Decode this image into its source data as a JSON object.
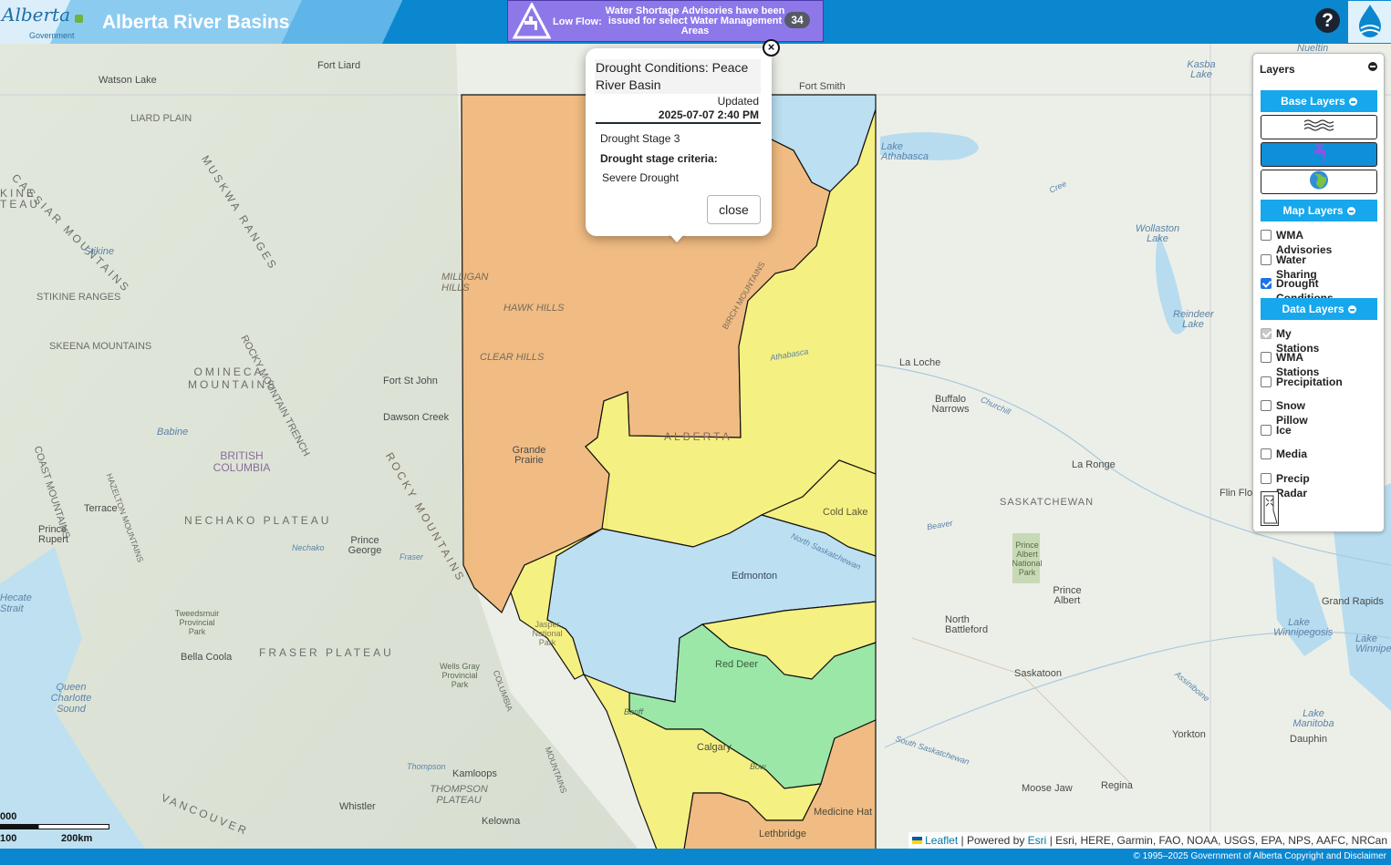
{
  "header": {
    "logo_text": "Alberta",
    "logo_sub": "Government",
    "title": "Alberta River Basins",
    "alert_label": "Low Flow:",
    "alert_message": "Water Shortage Advisories have been issued for select Water Management Areas",
    "alert_count": "34",
    "help_icon": "?"
  },
  "popup": {
    "title": "Drought Conditions: Peace River Basin",
    "updated_label": "Updated",
    "updated_date": "2025-07-07 2:40 PM",
    "stage": "Drought Stage 3",
    "criteria_label": "Drought stage criteria:",
    "criteria_value": "Severe Drought",
    "close_label": "close",
    "close_icon": "×"
  },
  "layers": {
    "title": "Layers",
    "base_layers_label": "Base Layers",
    "base_icons": [
      "waves-icon",
      "tap-icon",
      "globe-icon"
    ],
    "base_active_index": 1,
    "map_layers_label": "Map Layers",
    "map_layers": [
      {
        "label": "WMA Advisories",
        "checked": false,
        "disabled": false
      },
      {
        "label": "Water Sharing",
        "checked": false,
        "disabled": false
      },
      {
        "label": "Drought Conditions",
        "checked": true,
        "disabled": false
      }
    ],
    "data_layers_label": "Data Layers",
    "data_layers": [
      {
        "label": "My Stations",
        "checked": true,
        "disabled": true
      },
      {
        "label": "WMA Stations",
        "checked": false,
        "disabled": false
      },
      {
        "label": "Precipitation",
        "checked": false,
        "disabled": false
      },
      {
        "label": "Snow Pillow",
        "checked": false,
        "disabled": false
      },
      {
        "label": "Ice",
        "checked": false,
        "disabled": false
      },
      {
        "label": "Media",
        "checked": false,
        "disabled": false
      },
      {
        "label": "Precip Radar",
        "checked": false,
        "disabled": false
      }
    ]
  },
  "map": {
    "colors": {
      "severe": "#f0b77a",
      "moderate": "#f6ef7c",
      "normal": "#b9def2",
      "wet": "#97e6a4",
      "header": "#0b87d0",
      "alert": "#8e78e9"
    },
    "labels": {
      "fort_liard": "Fort Liard",
      "watson_lake": "Watson Lake",
      "liard_plain": "LIARD PLAIN",
      "cassiar": "CASSIAR MOUNTAINS",
      "muskwa": "MUSKWA RANGES",
      "kine_teau": "KINE TEAU",
      "stikine": "Stikine",
      "stikine_ranges": "STIKINE RANGES",
      "skeena": "SKEENA MOUNTAINS",
      "omineca": "OMINECA MOUNTAINS",
      "rocky_trench": "ROCKY MOUNTAIN TRENCH",
      "milligan": "MILLIGAN HILLS",
      "hawk": "HAWK HILLS",
      "clear": "CLEAR HILLS",
      "fort_st_john": "Fort St John",
      "dawson": "Dawson Creek",
      "babine": "Babine",
      "bc": "BRITISH COLUMBIA",
      "grande": "Grande Prairie",
      "terrace": "Terrace",
      "prince_rupert": "Prince Rupert",
      "nechako": "NECHAKO PLATEAU",
      "nechako_river": "Nechako",
      "prince_george": "Prince George",
      "fraser_river": "Fraser",
      "tweedsmuir": "Tweedsmuir Provincial Park",
      "bella": "Bella Coola",
      "fraser_plateau": "FRASER PLATEAU",
      "wells": "Wells Gray Provincial Park",
      "jasper": "Jasper National Park",
      "queen": "Queen Charlotte Sound",
      "hecate": "Hecate Strait",
      "thompson": "Thompson",
      "kamloops": "Kamloops",
      "thompson_plateau": "THOMPSON PLATEAU",
      "whistler": "Whistler",
      "kelowna": "Kelowna",
      "vancouver": "VANCOUVER",
      "fort_smith": "Fort Smith",
      "lake_athabasca": "Lake Athabasca",
      "nueltin": "Nueltin",
      "kasba": "Kasba Lake",
      "cree": "Cree",
      "wollaston": "Wollaston Lake",
      "reindeer": "Reindeer Lake",
      "la_loche": "La Loche",
      "buffalo": "Buffalo Narrows",
      "churchill": "Churchill",
      "la_ronge": "La Ronge",
      "saskatchewan": "SASKATCHEWAN",
      "flin": "Flin Flo",
      "beaver": "Beaver",
      "cold_lake": "Cold Lake",
      "edmonton": "Edmonton",
      "n_sask": "North Saskatchewan",
      "athabasca": "Athabasca",
      "prince_albert_park": "Prince Albert National Park",
      "prince_albert": "Prince Albert",
      "north_battleford": "North Battleford",
      "saskatoon": "Saskatoon",
      "grand_rapids": "Grand Rapids",
      "lake_winnipegosis": "Lake Winnipegosis",
      "lake_winnipeg": "Lake Winnipe",
      "assiniboine": "Assiniboine",
      "lake_manitoba": "Lake Manitoba",
      "yorkton": "Yorkton",
      "dauphin": "Dauphin",
      "s_sask": "South Saskatchewan",
      "moose_jaw": "Moose Jaw",
      "regina": "Regina",
      "red_deer": "Red Deer",
      "calgary": "Calgary",
      "medicine_hat": "Medicine Hat",
      "lethbridge": "Lethbridge",
      "columbia": "COLUMBIA",
      "rocky": "ROCKY MOUNTAINS",
      "birch": "BIRCH MOUNTAINS",
      "alberta_w": "ALBERTA",
      "banff": "Banff",
      "coast": "COAST MOUNTAINS",
      "hazelton": "HAZELTON MOUNTAINS",
      "monashee": "MOUNTAINS",
      "bow": "Bow"
    }
  },
  "scale": {
    "top": "000",
    "left": "100",
    "right": "200km"
  },
  "attribution": {
    "leaflet": "Leaflet",
    "powered": "| Powered by",
    "esri": "Esri",
    "sources": "| Esri, HERE, Garmin, FAO, NOAA, USGS, EPA, NPS, AAFC, NRCan"
  },
  "footer": "© 1995–2025 Government of Alberta Copyright and Disclaimer"
}
